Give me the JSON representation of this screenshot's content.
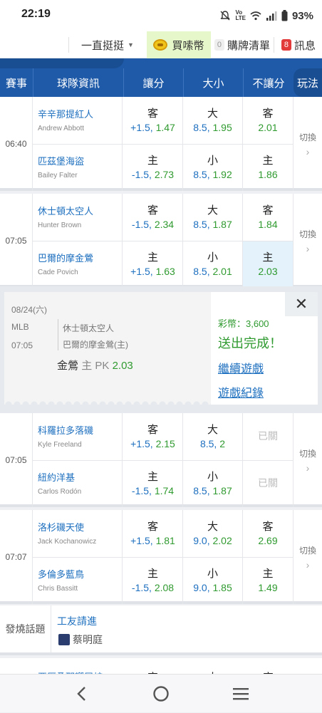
{
  "status_bar": {
    "time": "22:19",
    "battery": "93%"
  },
  "top_nav": {
    "filter": "一直挺挺",
    "buy_coins": "買嗦幣",
    "cart_count": "0",
    "cart": "購牌清單",
    "msg_count": "8",
    "messages": "訊息"
  },
  "table_header": {
    "event": "賽事",
    "team_info": "球隊資訊",
    "spread": "讓分",
    "total": "大小",
    "moneyline": "不讓分",
    "play": "玩法"
  },
  "games": [
    {
      "time": "06:40",
      "away": {
        "zh": "辛辛那提紅人",
        "en": "Andrew Abbott",
        "spread_side": "客",
        "spread_line": "+1.5,",
        "spread_odds": "1.47",
        "total_side": "大",
        "total_line": "8.5,",
        "total_odds": "1.95",
        "ml_side": "客",
        "ml_odds": "2.01"
      },
      "home": {
        "zh": "匹茲堡海盜",
        "en": "Bailey Falter",
        "spread_side": "主",
        "spread_line": "-1.5,",
        "spread_odds": "2.73",
        "total_side": "小",
        "total_line": "8.5,",
        "total_odds": "1.92",
        "ml_side": "主",
        "ml_odds": "1.86"
      },
      "switch": "切換"
    },
    {
      "time": "07:05",
      "away": {
        "zh": "休士頓太空人",
        "en": "Hunter Brown",
        "spread_side": "客",
        "spread_line": "-1.5,",
        "spread_odds": "2.34",
        "total_side": "大",
        "total_line": "8.5,",
        "total_odds": "1.87",
        "ml_side": "客",
        "ml_odds": "1.84"
      },
      "home": {
        "zh": "巴爾的摩金鶯",
        "en": "Cade Povich",
        "spread_side": "主",
        "spread_line": "+1.5,",
        "spread_odds": "1.63",
        "total_side": "小",
        "total_line": "8.5,",
        "total_odds": "2.01",
        "ml_side": "主",
        "ml_odds": "2.03"
      },
      "switch": "切換"
    },
    {
      "time": "07:05",
      "away": {
        "zh": "科羅拉多落磯",
        "en": "Kyle Freeland",
        "spread_side": "客",
        "spread_line": "+1.5,",
        "spread_odds": "2.15",
        "total_side": "大",
        "total_line": "8.5,",
        "total_odds": "2",
        "ml_closed": "已關"
      },
      "home": {
        "zh": "紐約洋基",
        "en": "Carlos Rodón",
        "spread_side": "主",
        "spread_line": "-1.5,",
        "spread_odds": "1.74",
        "total_side": "小",
        "total_line": "8.5,",
        "total_odds": "1.87",
        "ml_closed": "已關"
      },
      "switch": "切換"
    },
    {
      "time": "07:07",
      "away": {
        "zh": "洛杉磯天使",
        "en": "Jack Kochanowicz",
        "spread_side": "客",
        "spread_line": "+1.5,",
        "spread_odds": "1.81",
        "total_side": "大",
        "total_line": "9.0,",
        "total_odds": "2.02",
        "ml_side": "客",
        "ml_odds": "2.69"
      },
      "home": {
        "zh": "多倫多藍鳥",
        "en": "Chris Bassitt",
        "spread_side": "主",
        "spread_line": "-1.5,",
        "spread_odds": "2.08",
        "total_side": "小",
        "total_line": "9.0,",
        "total_odds": "1.85",
        "ml_side": "主",
        "ml_odds": "1.49"
      },
      "switch": "切換"
    }
  ],
  "ticket": {
    "date": "08/24(六)",
    "league": "MLB",
    "time": "07:05",
    "team1": "休士頓太空人",
    "team2": "巴爾的摩金鶯(主)",
    "pick_team": "金鶯",
    "pick_side": "主",
    "pick_type": "PK",
    "pick_odds": "2.03",
    "coins": "彩幣：3,600",
    "status": "送出完成！",
    "continue": "繼續遊戲",
    "history": "遊戲紀錄"
  },
  "hot_topic": {
    "label": "發燒話題",
    "title": "工友請進",
    "author": "蔡明庭"
  },
  "peek_row": {
    "team": "亞歷桑那響尾蛇",
    "spread_side": "客",
    "total_side": "大",
    "ml_side": "客"
  }
}
